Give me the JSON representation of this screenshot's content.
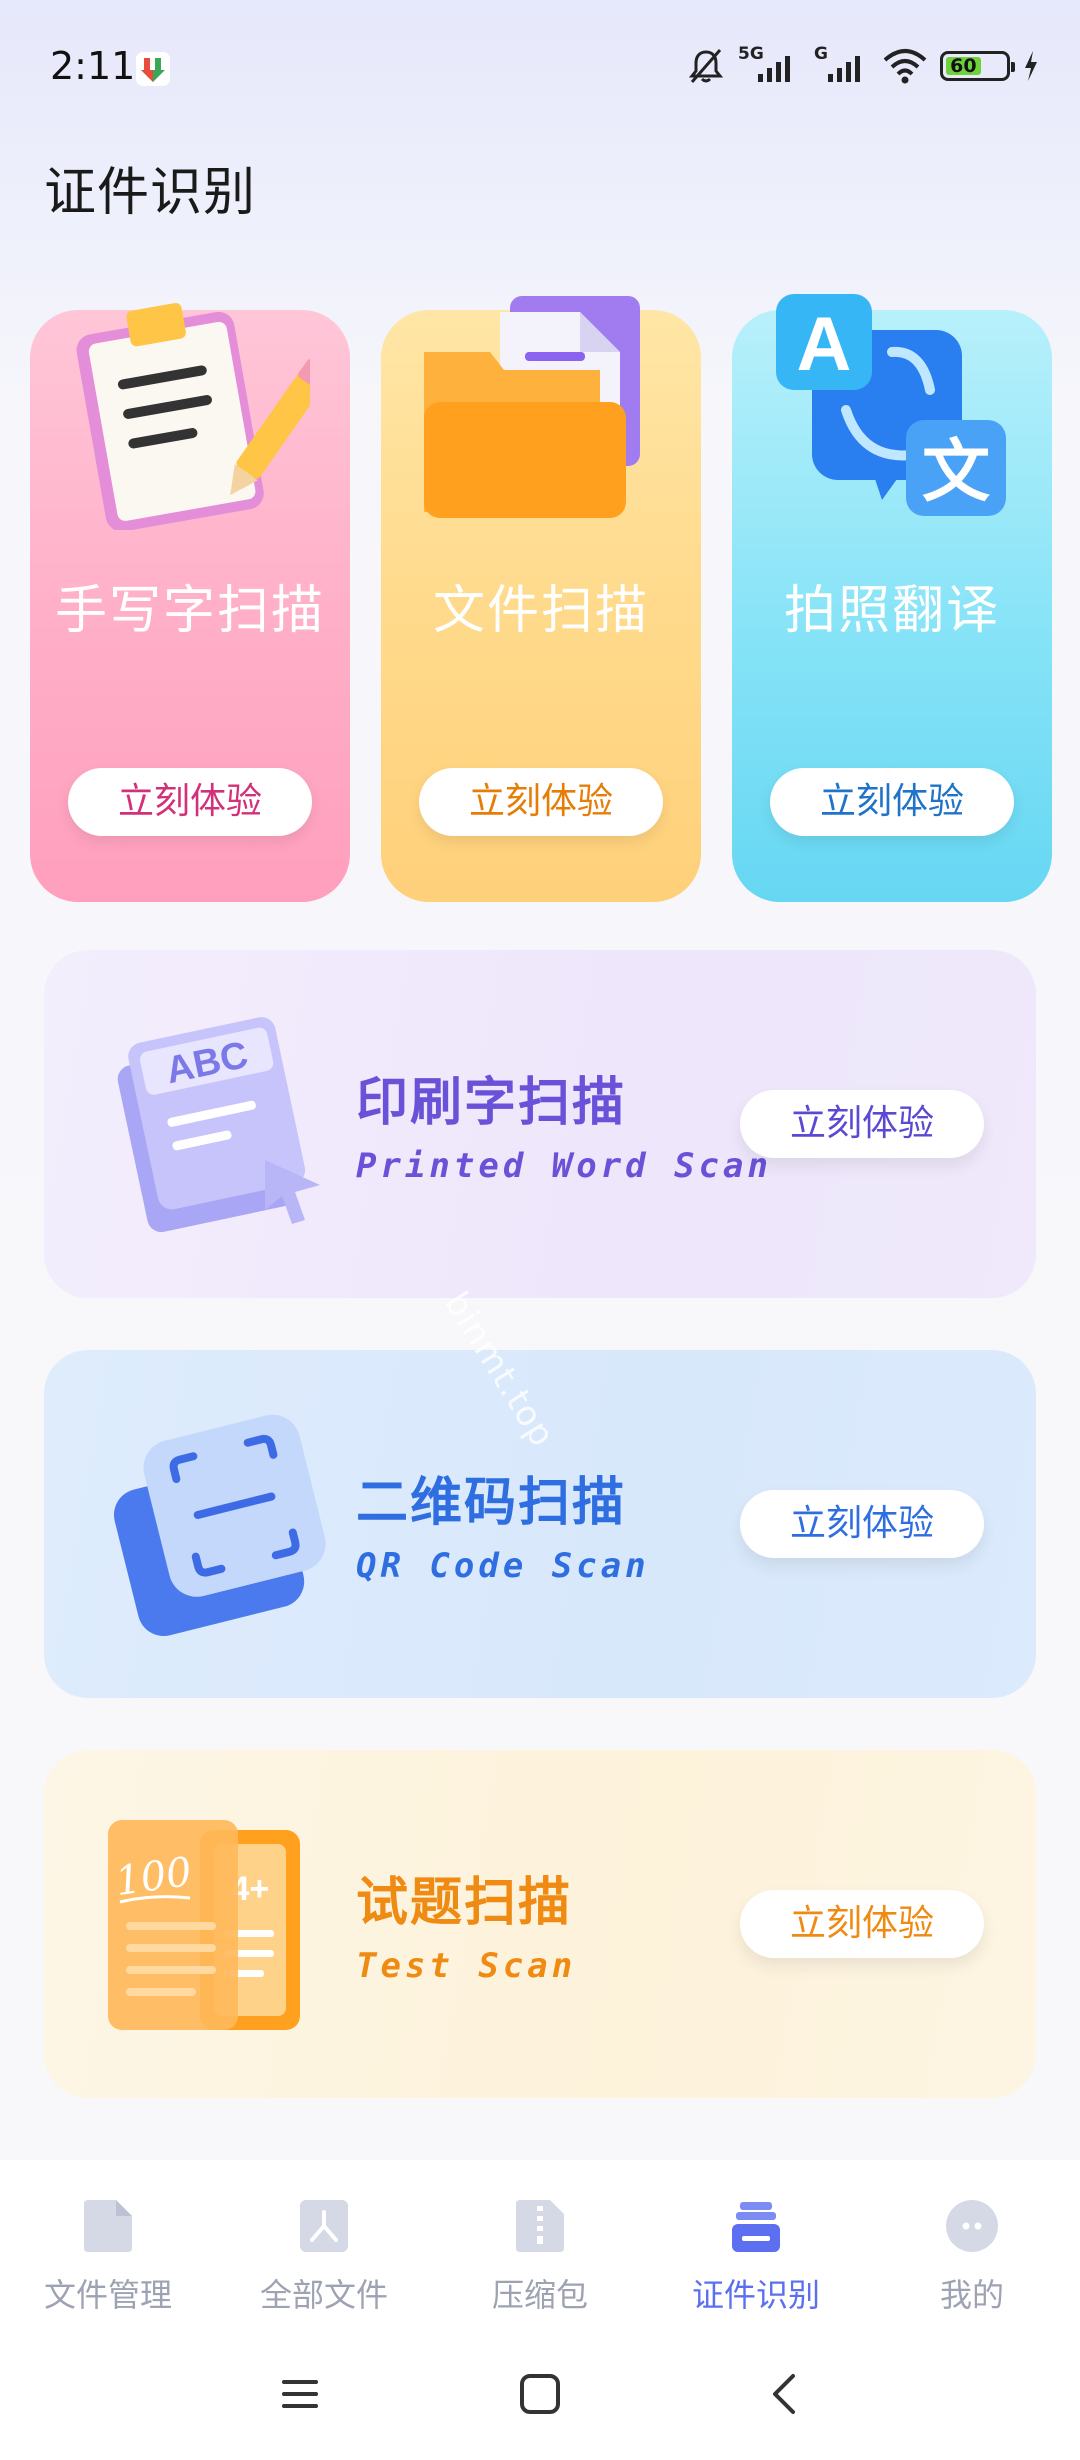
{
  "status_bar": {
    "time": "2:11",
    "network_5g": "5G",
    "network_g": "G",
    "battery_level": "60"
  },
  "page": {
    "title": "证件识别"
  },
  "top_cards": [
    {
      "title": "手写字扫描",
      "button": "立刻体验",
      "icon": "handwriting-clipboard-icon",
      "color": "#ff9fbd"
    },
    {
      "title": "文件扫描",
      "button": "立刻体验",
      "icon": "folder-document-icon",
      "color": "#ffd07a"
    },
    {
      "title": "拍照翻译",
      "button": "立刻体验",
      "icon": "translate-icon",
      "color": "#66d7f3"
    }
  ],
  "wide_cards": [
    {
      "title": "印刷字扫描",
      "subtitle": "Printed Word Scan",
      "button": "立刻体验",
      "icon": "printed-document-icon",
      "color": "#6a52d8",
      "illus_text": "ABC"
    },
    {
      "title": "二维码扫描",
      "subtitle": "QR Code Scan",
      "button": "立刻体验",
      "icon": "qr-scan-icon",
      "color": "#2f6ee0"
    },
    {
      "title": "试题扫描",
      "subtitle": "Test Scan",
      "button": "立刻体验",
      "icon": "test-paper-icon",
      "color": "#ef8a12",
      "illus_text": "100"
    }
  ],
  "watermark": "binmt.top",
  "bottom_nav": {
    "items": [
      {
        "label": "文件管理",
        "icon": "file-icon",
        "active": false
      },
      {
        "label": "全部文件",
        "icon": "pdf-file-icon",
        "active": false
      },
      {
        "label": "压缩包",
        "icon": "zip-file-icon",
        "active": false
      },
      {
        "label": "证件识别",
        "icon": "id-scan-icon",
        "active": true
      },
      {
        "label": "我的",
        "icon": "profile-icon",
        "active": false
      }
    ],
    "active_color": "#5b6ff0",
    "inactive_color": "#9ea3b3"
  }
}
